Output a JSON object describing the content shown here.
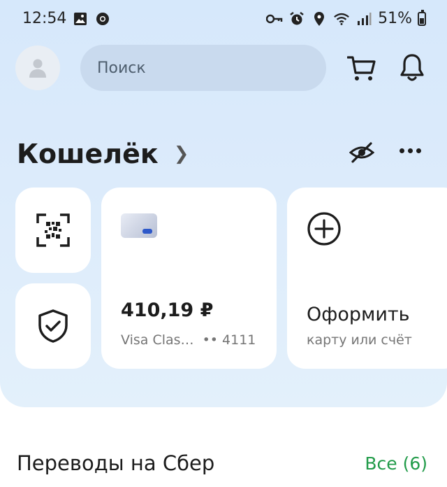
{
  "status_bar": {
    "time": "12:54",
    "battery": "51%"
  },
  "header": {
    "search_placeholder": "Поиск"
  },
  "wallet": {
    "title": "Кошелёк",
    "card": {
      "balance": "410,19 ₽",
      "name": "Visa Clas…",
      "number_masked": "•• 4111"
    },
    "new_product": {
      "title": "Оформить",
      "subtitle": "карту или счёт"
    }
  },
  "transfers": {
    "title": "Переводы на Сбер",
    "all_label": "Все (6)"
  },
  "colors": {
    "accent_green": "#219b49",
    "card_chip": "#2d58c9",
    "background_top": "#d6e8fb"
  }
}
